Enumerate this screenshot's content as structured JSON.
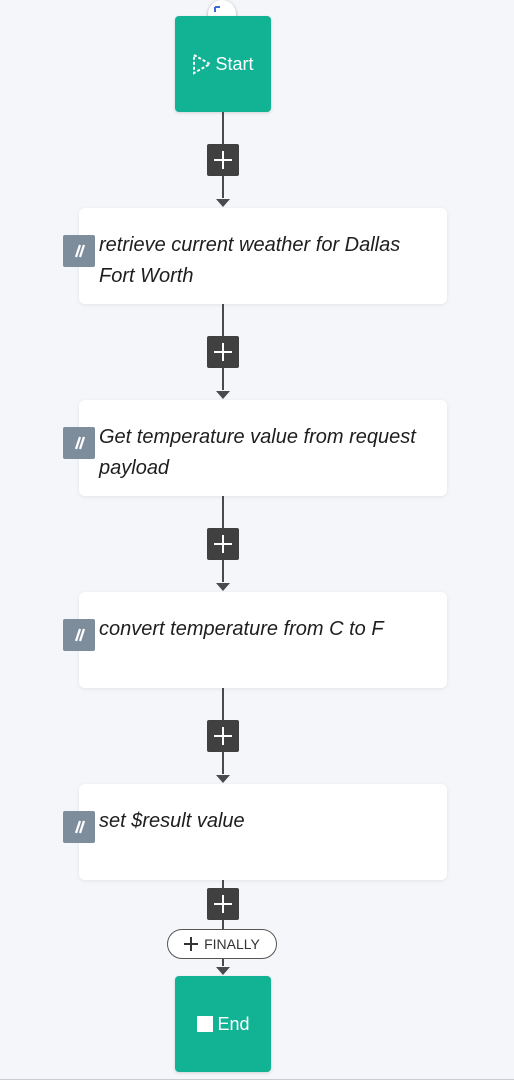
{
  "flow": {
    "start_label": "Start",
    "end_label": "End",
    "finally_label": "FINALLY",
    "steps": [
      {
        "label": "retrieve current weather for Dallas Fort Worth",
        "icon": "script-step-icon"
      },
      {
        "label": "Get temperature value from request payload",
        "icon": "script-step-icon"
      },
      {
        "label": "convert temperature from C to F",
        "icon": "script-step-icon"
      },
      {
        "label": "set $result value",
        "icon": "script-step-icon"
      }
    ]
  },
  "colors": {
    "terminal": "#12b294",
    "connector": "#4a4a4a",
    "add_button": "#404040",
    "step_icon": "#7e8d9b",
    "background": "#f4f6f9"
  }
}
